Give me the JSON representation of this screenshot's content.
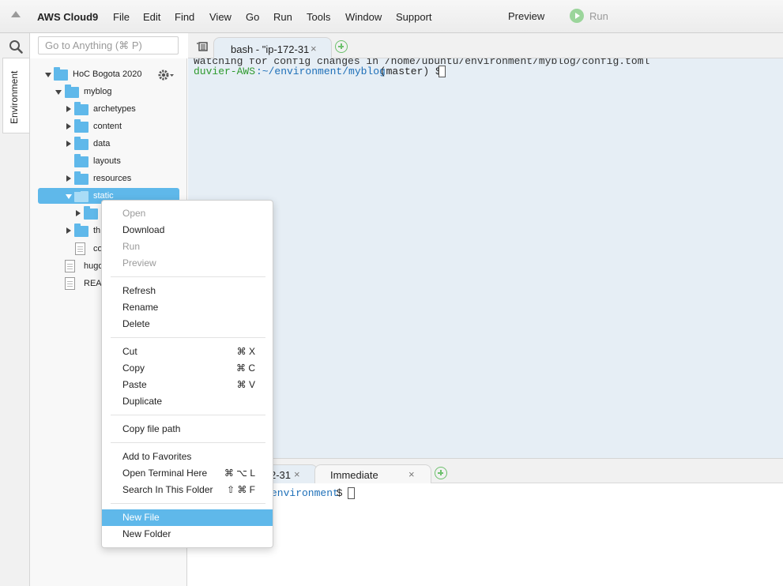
{
  "menubar": {
    "brand": "AWS Cloud9",
    "items": [
      "File",
      "Edit",
      "Find",
      "View",
      "Go",
      "Run",
      "Tools",
      "Window",
      "Support"
    ],
    "preview_label": "Preview",
    "run_label": "Run"
  },
  "sidebar": {
    "tab_label": "Environment",
    "search_placeholder": "Go to Anything (⌘ P)"
  },
  "tree": {
    "root": "HoC Bogota 2020",
    "rows": [
      {
        "label": "myblog"
      },
      {
        "label": "archetypes"
      },
      {
        "label": "content"
      },
      {
        "label": "data"
      },
      {
        "label": "layouts"
      },
      {
        "label": "resources"
      },
      {
        "label": "static"
      },
      {
        "label": ""
      },
      {
        "label": "th"
      },
      {
        "label": "co"
      },
      {
        "label": "hugo"
      },
      {
        "label": "READ"
      }
    ]
  },
  "editor": {
    "tab_label": "bash - \"ip-172-31",
    "tab_close": "×",
    "terminal_line0": "Watching for config changes in /home/ubuntu/environment/myblog/config.toml",
    "prompt_user": "duvier-AWS",
    "prompt_path": ":~/environment/myblog",
    "prompt_rest": " (master) $ "
  },
  "bottom_panel": {
    "tab1_label": "2-31",
    "tab1_close": "×",
    "tab2_label": "Immediate",
    "tab2_close": "×",
    "term_path": "environment",
    "term_rest": " $ "
  },
  "context_menu": {
    "items": [
      {
        "label": "Open",
        "shortcut": "",
        "disabled": true
      },
      {
        "label": "Download",
        "shortcut": "",
        "disabled": false
      },
      {
        "label": "Run",
        "shortcut": "",
        "disabled": true
      },
      {
        "label": "Preview",
        "shortcut": "",
        "disabled": true
      },
      {
        "label": "Refresh",
        "shortcut": "",
        "disabled": false
      },
      {
        "label": "Rename",
        "shortcut": "",
        "disabled": false
      },
      {
        "label": "Delete",
        "shortcut": "",
        "disabled": false
      },
      {
        "label": "Cut",
        "shortcut": "⌘ X",
        "disabled": false
      },
      {
        "label": "Copy",
        "shortcut": "⌘ C",
        "disabled": false
      },
      {
        "label": "Paste",
        "shortcut": "⌘ V",
        "disabled": false
      },
      {
        "label": "Duplicate",
        "shortcut": "",
        "disabled": false
      },
      {
        "label": "Copy file path",
        "shortcut": "",
        "disabled": false
      },
      {
        "label": "Add to Favorites",
        "shortcut": "",
        "disabled": false
      },
      {
        "label": "Open Terminal Here",
        "shortcut": "⌘ ⌥ L",
        "disabled": false
      },
      {
        "label": "Search In This Folder",
        "shortcut": "⇧ ⌘ F",
        "disabled": false
      },
      {
        "label": "New File",
        "shortcut": "",
        "disabled": false,
        "highlighted": true
      },
      {
        "label": "New Folder",
        "shortcut": "",
        "disabled": false
      }
    ]
  },
  "colors": {
    "accent": "#5fb8ea",
    "terminal_bg": "#e6eef5",
    "prompt_user": "#2e9a2e",
    "prompt_path": "#1d6fb8",
    "run_green": "#9bd59b"
  }
}
